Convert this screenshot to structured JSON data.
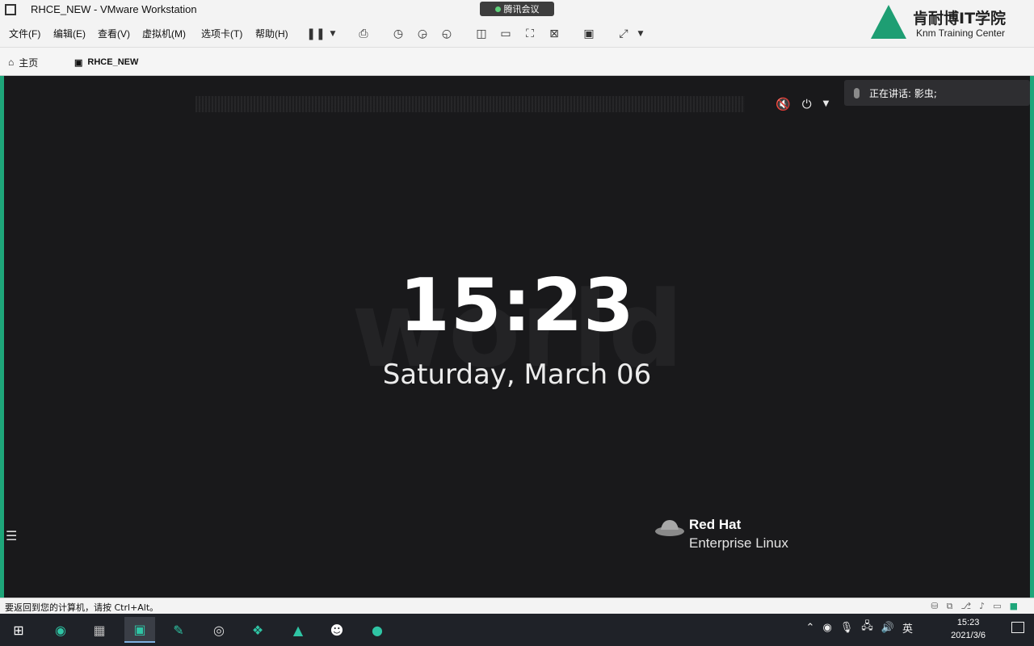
{
  "window": {
    "title": "RHCE_NEW - VMware Workstation"
  },
  "meeting_indicator": {
    "label": "腾讯会议"
  },
  "menu": {
    "items": [
      "文件(F)",
      "编辑(E)",
      "查看(V)",
      "虚拟机(M)",
      "选项卡(T)",
      "帮助(H)"
    ]
  },
  "toolbar": {
    "icons": [
      "pause-icon",
      "dropdown-icon",
      "send-keys-icon",
      "snapshot-icon",
      "snapshot-revert-icon",
      "snapshot-manager-icon",
      "library-icon",
      "console-view-icon",
      "fullscreen-icon",
      "unity-icon",
      "terminal-icon",
      "stretch-icon",
      "dropdown-icon"
    ]
  },
  "logo": {
    "name_cn": "肯耐博IT学院",
    "name_en": "Knm Training Center"
  },
  "tabs": [
    {
      "label": "主页",
      "icon": "home-icon"
    },
    {
      "label": "RHCE_NEW",
      "icon": "vm-icon"
    }
  ],
  "vm_screen": {
    "time": "15:23",
    "date": "Saturday, March 06",
    "background_word": "world",
    "brand_line1": "Red Hat",
    "brand_line2": "Enterprise Linux",
    "system_icons": [
      "volume-muted-icon",
      "power-icon",
      "chevron-down-icon"
    ]
  },
  "speaker_overlay": {
    "text": "正在讲话: 影虫;"
  },
  "statusbar": {
    "message": "要返回到您的计算机，请按 Ctrl+Alt。"
  },
  "taskbar": {
    "apps": [
      "start-icon",
      "edge-icon",
      "remote-desktop-icon",
      "vmware-icon",
      "pen-icon",
      "obs-icon",
      "network-icon",
      "meeting-icon",
      "qq-icon",
      "drop-icon"
    ],
    "tray": {
      "ime": "英",
      "time": "15:23",
      "date": "2021/3/6"
    }
  },
  "colors": {
    "accent_green": "#1ea67a",
    "vm_background": "#19191b"
  }
}
